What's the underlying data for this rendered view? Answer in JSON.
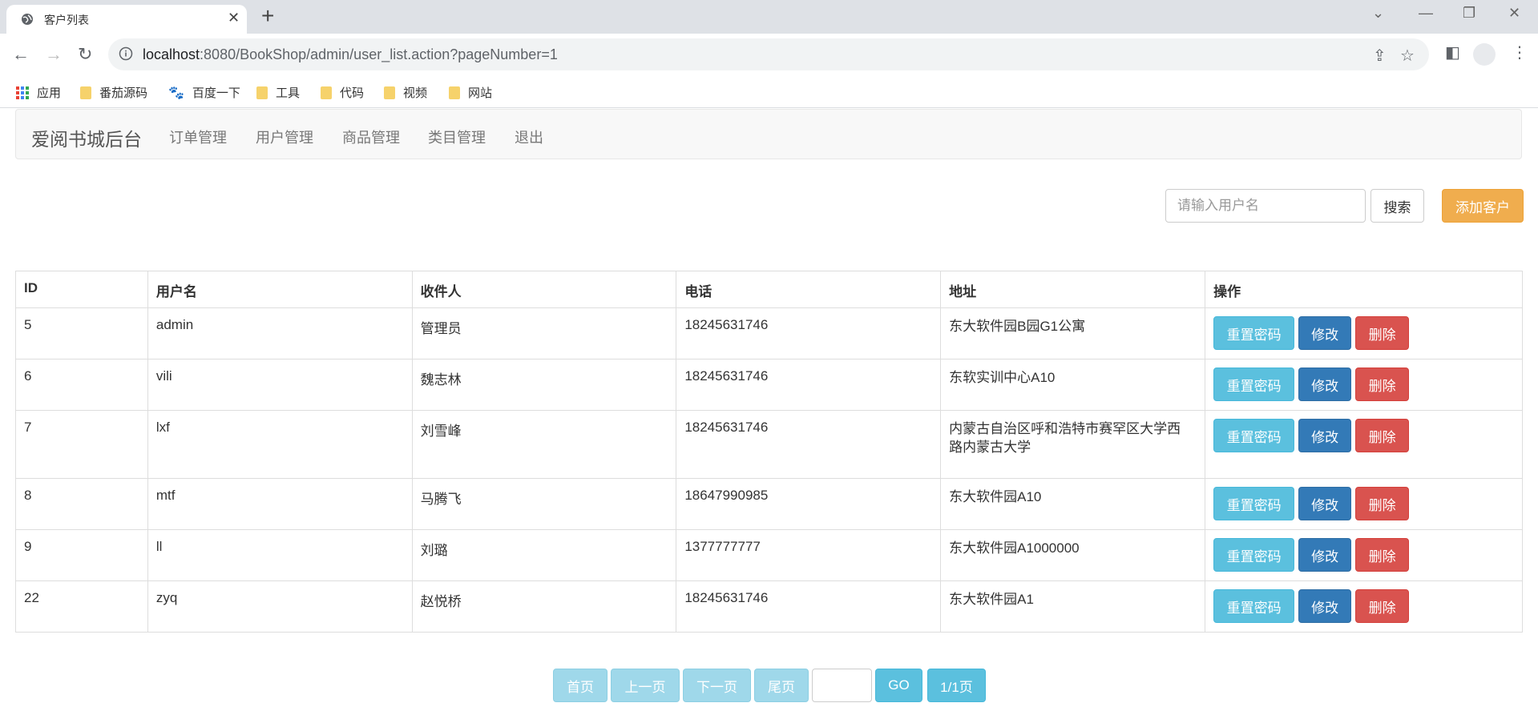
{
  "browser": {
    "tab_title": "客户列表",
    "url_host": "localhost",
    "url_rest": ":8080/BookShop/admin/user_list.action?pageNumber=1",
    "bookmarks": [
      "应用",
      "番茄源码",
      "百度一下",
      "工具",
      "代码",
      "视频",
      "网站"
    ]
  },
  "navbar": {
    "brand": "爱阅书城后台",
    "links": [
      "订单管理",
      "用户管理",
      "商品管理",
      "类目管理",
      "退出"
    ]
  },
  "search": {
    "placeholder": "请输入用户名",
    "button": "搜索",
    "add_button": "添加客户"
  },
  "table": {
    "headers": [
      "ID",
      "用户名",
      "收件人",
      "电话",
      "地址",
      "操作"
    ],
    "rows": [
      {
        "id": "5",
        "username": "admin",
        "recipient": "管理员",
        "phone": "18245631746",
        "address": "东大软件园B园G1公寓"
      },
      {
        "id": "6",
        "username": "vili",
        "recipient": "魏志林",
        "phone": "18245631746",
        "address": "东软实训中心A10"
      },
      {
        "id": "7",
        "username": "lxf",
        "recipient": "刘雪峰",
        "phone": "18245631746",
        "address": "内蒙古自治区呼和浩特市赛罕区大学西路内蒙古大学"
      },
      {
        "id": "8",
        "username": "mtf",
        "recipient": "马腾飞",
        "phone": "18647990985",
        "address": "东大软件园A10"
      },
      {
        "id": "9",
        "username": "ll",
        "recipient": "刘璐",
        "phone": "1377777777",
        "address": "东大软件园A1000000"
      },
      {
        "id": "22",
        "username": "zyq",
        "recipient": "赵悦桥",
        "phone": "18245631746",
        "address": "东大软件园A1"
      }
    ],
    "actions": {
      "reset": "重置密码",
      "edit": "修改",
      "delete": "删除"
    }
  },
  "pagination": {
    "first": "首页",
    "prev": "上一页",
    "next": "下一页",
    "last": "尾页",
    "go": "GO",
    "page_info": "1/1页",
    "page_input_value": ""
  },
  "colors": {
    "info": "#5bc0de",
    "primary": "#337ab7",
    "danger": "#d9534f",
    "warning": "#f0ad4e"
  }
}
